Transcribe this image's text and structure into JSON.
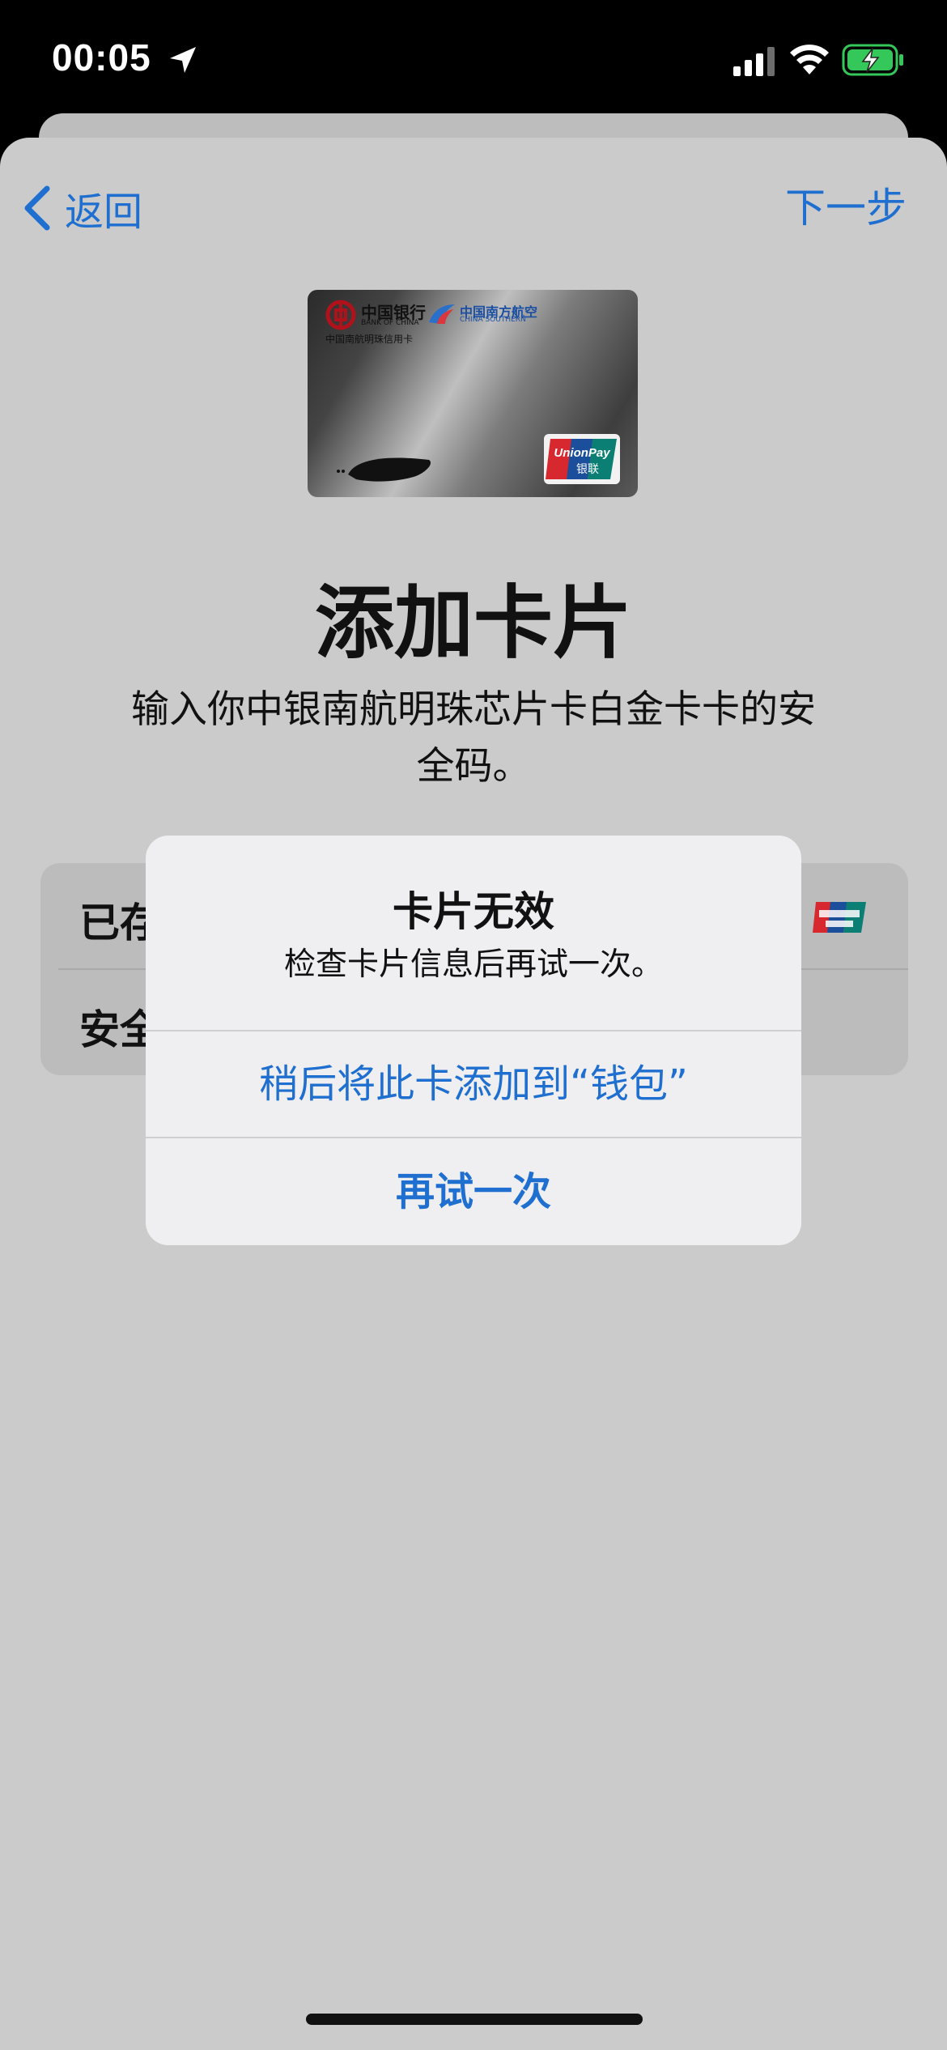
{
  "status_bar": {
    "time": "00:05",
    "location_icon": "location-arrow-icon",
    "signal_icon": "cellular-signal-icon",
    "wifi_icon": "wifi-icon",
    "battery_icon": "battery-charging-icon",
    "battery_color": "#34c759"
  },
  "nav": {
    "back_label": "返回",
    "next_label": "下一步",
    "accent_color": "#1f6fd0"
  },
  "card": {
    "bank_name": "中国银行",
    "bank_name_en": "BANK OF CHINA",
    "product_name": "中国南航明珠信用卡",
    "airline_name": "中国南方航空",
    "airline_name_en": "CHINA SOUTHERN",
    "network_logo": "unionpay-logo",
    "network_text": "UnionPay",
    "network_text_cn": "银联"
  },
  "page": {
    "title": "添加卡片",
    "subtitle": "输入你中银南航明珠芯片卡白金卡卡的安全码。"
  },
  "form": {
    "row1_label": "已存",
    "row2_label": "安全"
  },
  "alert": {
    "title": "卡片无效",
    "message": "检查卡片信息后再试一次。",
    "later_button": "稍后将此卡添加到“钱包”",
    "retry_button": "再试一次"
  }
}
